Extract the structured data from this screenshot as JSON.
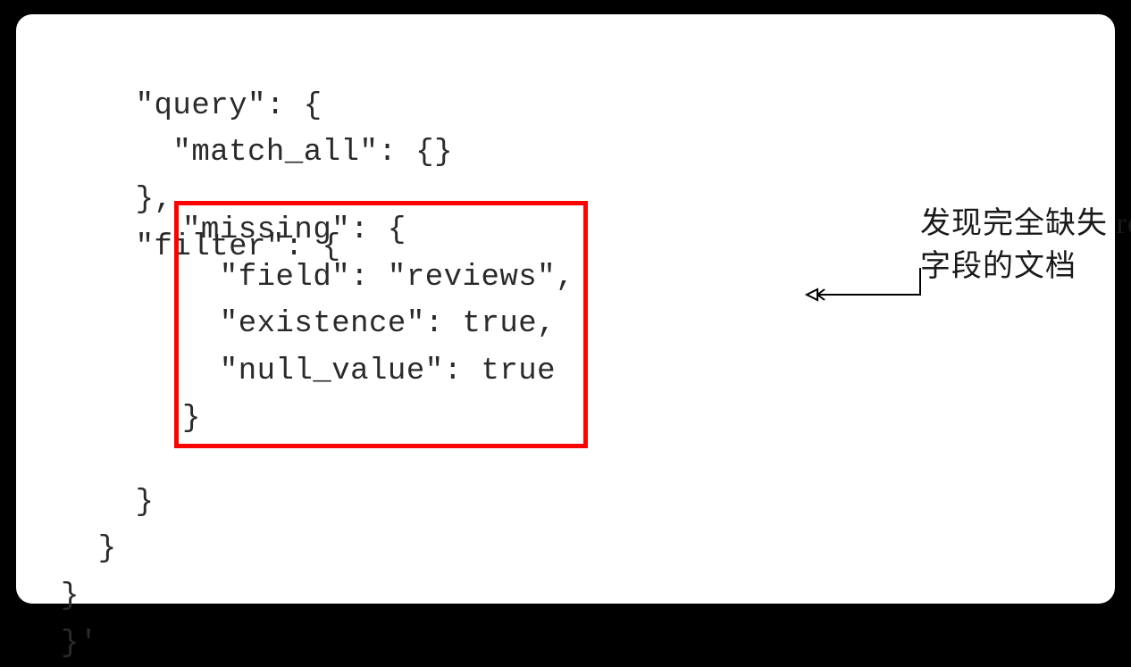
{
  "code": {
    "line1": "    \"query\": {",
    "line2": "      \"match_all\": {}",
    "line3": "    },",
    "line4": "    \"filter\": {",
    "boxed": {
      "b1": "\"missing\": {",
      "b2": "  \"field\": \"reviews\",",
      "b3": "  \"existence\": true,",
      "b4": "  \"null_value\": true",
      "b5": "}"
    },
    "line10": "    }",
    "line11": "  }",
    "line12": "}",
    "line13": "}'"
  },
  "annotation": {
    "line1": "发现完全缺失 reviews",
    "line2": "字段的文档"
  }
}
